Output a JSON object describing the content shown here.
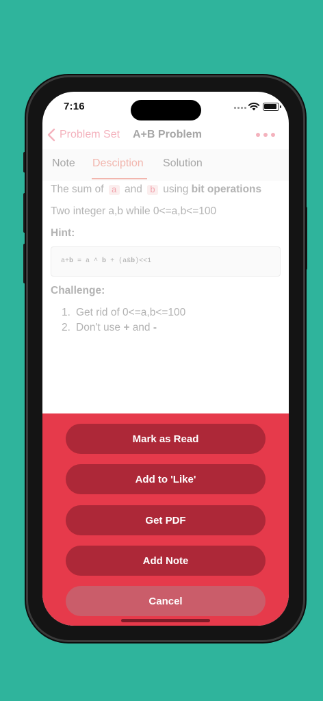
{
  "status_bar": {
    "time": "7:16"
  },
  "nav": {
    "back_label": "Problem Set",
    "title": "A+B Problem"
  },
  "tabs": [
    {
      "label": "Note"
    },
    {
      "label": "Desciption"
    },
    {
      "label": "Solution"
    }
  ],
  "content": {
    "line1": {
      "prefix": "The sum of",
      "var_a": "a",
      "and": "and",
      "var_b": "b",
      "using": "using",
      "emphasis": "bit operations"
    },
    "line2": "Two integer a,b while 0<=a,b<=100",
    "hint_heading": "Hint:",
    "code": {
      "p1": "a+",
      "b1": "b",
      "p2": " = a ^ ",
      "b2": "b",
      "p3": " + (a&",
      "b3": "b",
      "p4": ")<<1"
    },
    "challenge_heading": "Challenge:",
    "challenges": [
      {
        "num": "1.",
        "text": "Get rid of 0<=a,b<=100"
      },
      {
        "num": "2.",
        "prefix": "Don't use",
        "op1": "+",
        "mid": "and",
        "op2": "-"
      }
    ]
  },
  "action_sheet": {
    "buttons": [
      {
        "label": "Mark as Read"
      },
      {
        "label": "Add to 'Like'"
      },
      {
        "label": "Get PDF"
      },
      {
        "label": "Add Note"
      },
      {
        "label": "Cancel"
      }
    ]
  },
  "colors": {
    "background": "#2fb49c",
    "accent_pink": "#f4b2bd",
    "sheet_red": "#e63a4b",
    "sheet_button": "#ad2838",
    "cancel_button": "#ca5d6a"
  },
  "icons": [
    "chevron-left-icon",
    "more-dots-icon",
    "wifi-icon",
    "battery-icon",
    "signal-icon"
  ]
}
